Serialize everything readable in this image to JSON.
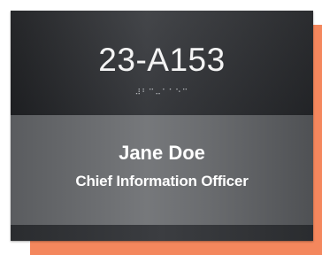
{
  "sign": {
    "room_number": "23-A153",
    "braille_text": "⠼⠃⠉⠤⠁⠁⠑⠉",
    "name": "Jane Doe",
    "title": "Chief Information Officer"
  },
  "colors": {
    "accent": "#f4875d",
    "panel_dark": "#2e3033",
    "panel_mid": "#6a6c6f",
    "text": "#ffffff"
  }
}
